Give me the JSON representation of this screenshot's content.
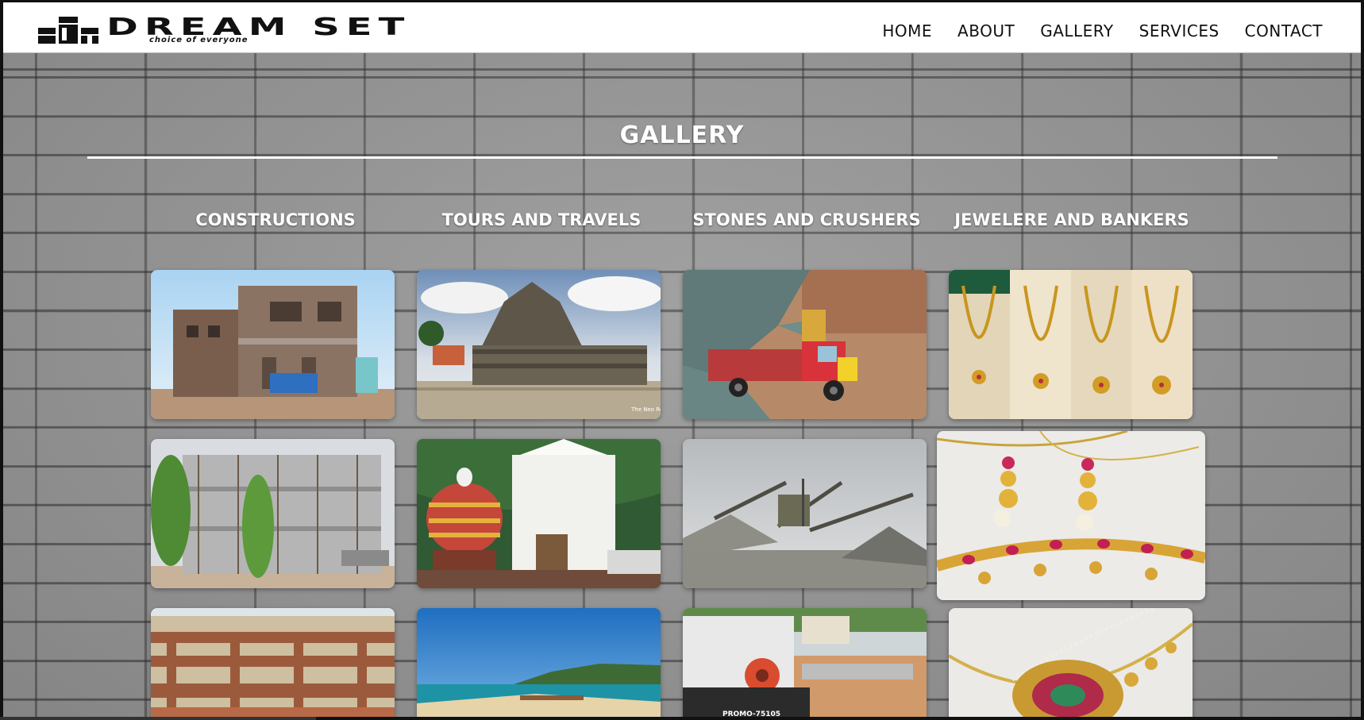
{
  "brand": {
    "name": "DREAM SET",
    "tagline": "choice of everyone"
  },
  "nav": {
    "items": [
      "HOME",
      "ABOUT",
      "GALLERY",
      "SERVICES",
      "CONTACT"
    ]
  },
  "gallery": {
    "title": "GALLERY",
    "columns": [
      {
        "heading": "CONSTRUCTIONS"
      },
      {
        "heading": "TOURS AND TRAVELS"
      },
      {
        "heading": "STONES AND CRUSHERS"
      },
      {
        "heading": "JEWELERE AND BANKERS"
      }
    ],
    "photo_watermark": "The Neo Road",
    "crusher_plate": "PROMO-75105"
  },
  "colors": {
    "navbar_bg": "#ffffff",
    "wall": "#979797",
    "heading_text": "#ffffff"
  }
}
